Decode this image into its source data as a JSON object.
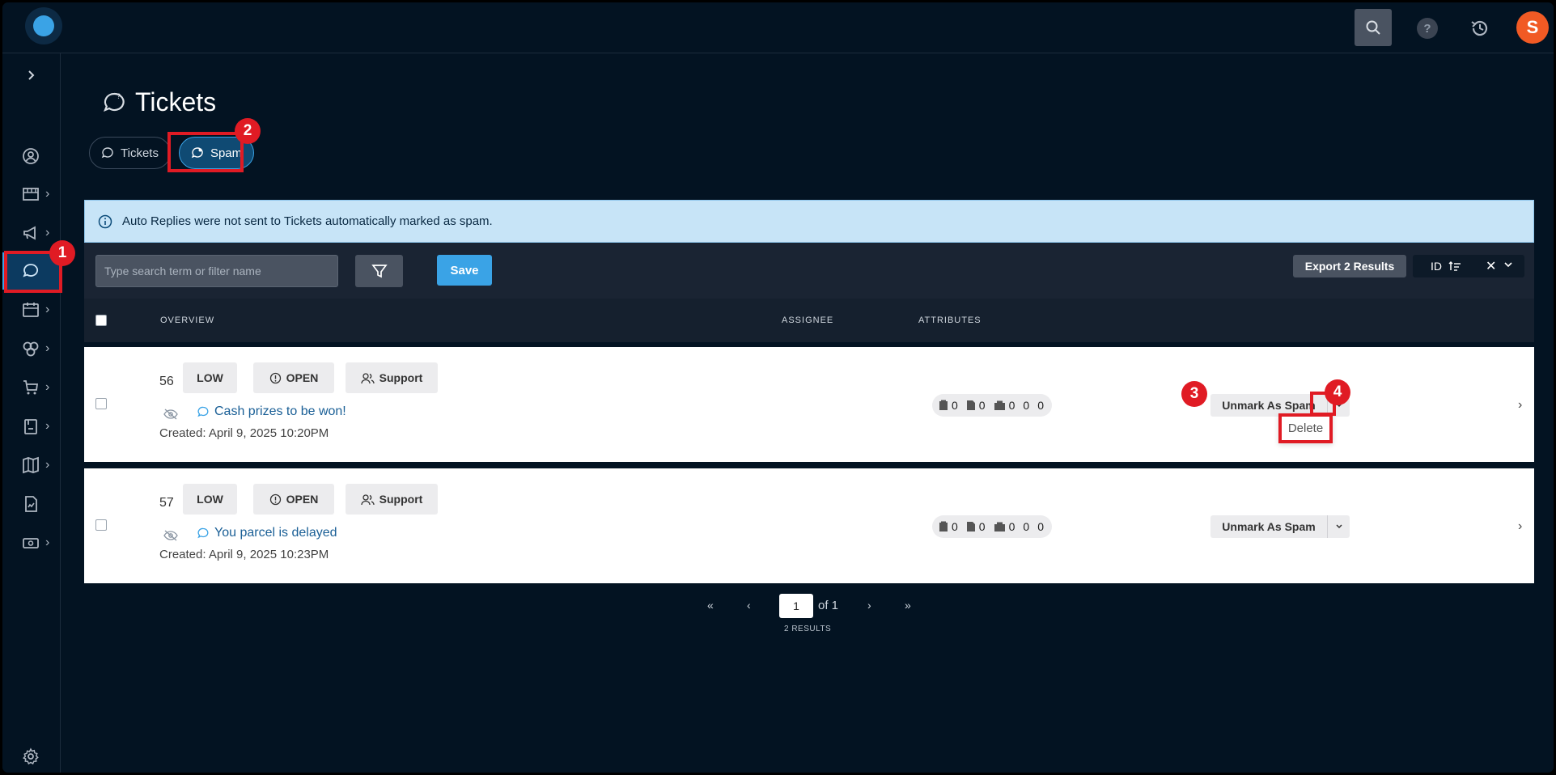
{
  "topbar": {
    "avatar_letter": "S",
    "help_label": "?"
  },
  "page": {
    "title": "Tickets"
  },
  "tabs": [
    {
      "label": "Tickets"
    },
    {
      "label": "Spam"
    }
  ],
  "banner": {
    "text": "Auto Replies were not sent to Tickets automatically marked as spam."
  },
  "toolbar": {
    "search_placeholder": "Type search term or filter name",
    "save_label": "Save",
    "export_label": "Export 2 Results",
    "sort_label": "ID"
  },
  "table": {
    "headers": {
      "overview": "OVERVIEW",
      "assignee": "ASSIGNEE",
      "attributes": "ATTRIBUTES"
    },
    "rows": [
      {
        "id": "56",
        "priority": "LOW",
        "status": "OPEN",
        "team": "Support",
        "title": "Cash prizes to be won!",
        "created": "Created: April 9, 2025 10:20PM",
        "attr_counts": [
          "0",
          "0",
          "0",
          "0",
          "0"
        ],
        "action_label": "Unmark As Spam"
      },
      {
        "id": "57",
        "priority": "LOW",
        "status": "OPEN",
        "team": "Support",
        "title": "You parcel is delayed",
        "created": "Created: April 9, 2025 10:23PM",
        "attr_counts": [
          "0",
          "0",
          "0",
          "0",
          "0"
        ],
        "action_label": "Unmark As Spam"
      }
    ],
    "dropdown": {
      "delete_label": "Delete"
    }
  },
  "pagination": {
    "first": "«",
    "prev": "‹",
    "current": "1",
    "of_label": "of 1",
    "next": "›",
    "last": "»",
    "results": "2 RESULTS"
  },
  "annotations": [
    "1",
    "2",
    "3",
    "4"
  ],
  "colors": {
    "background": "#031322",
    "accent": "#3aa3e6",
    "highlight": "#e01b24",
    "avatar": "#f15a24"
  }
}
